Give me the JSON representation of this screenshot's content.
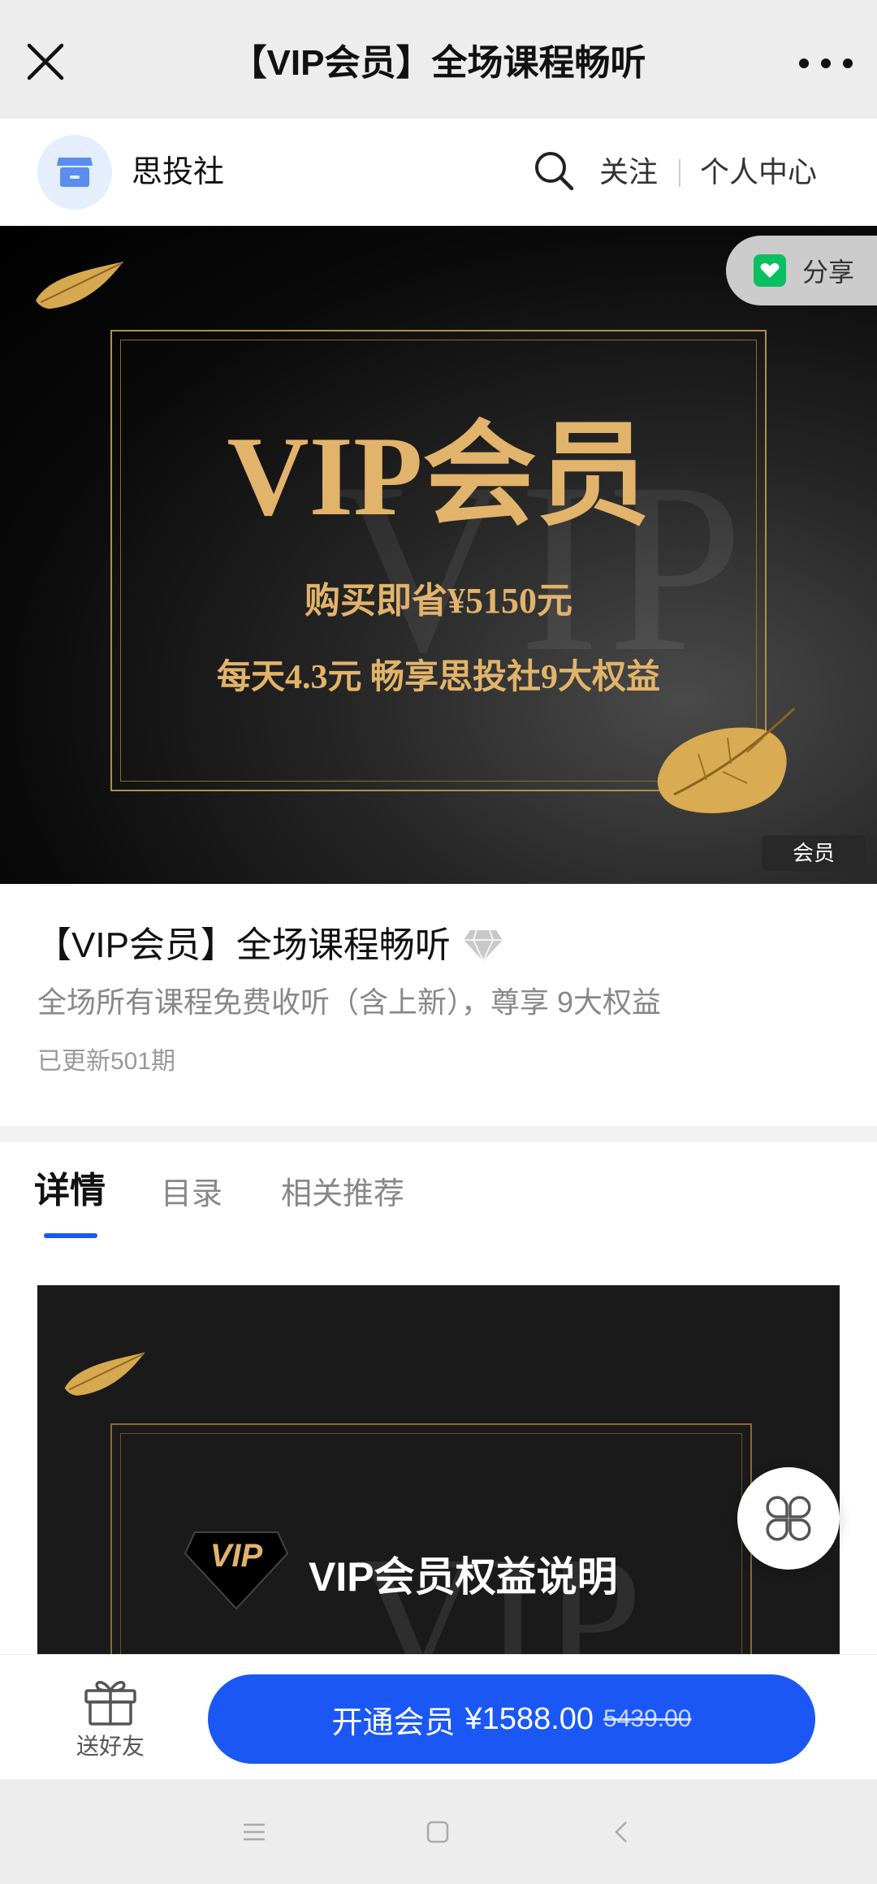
{
  "window": {
    "title": "【VIP会员】全场课程畅听"
  },
  "shop": {
    "name": "思投社",
    "follow_label": "关注",
    "center_label": "个人中心"
  },
  "banner": {
    "headline": "VIP会员",
    "line1": "购买即省¥5150元",
    "line2": "每天4.3元  畅享思投社9大权益",
    "watermark": "VIP",
    "badge": "会员",
    "share_label": "分享",
    "gold_color": "#e2b36a"
  },
  "product": {
    "title": "【VIP会员】全场课程畅听",
    "description": "全场所有课程免费收听（含上新），尊享 9大权益",
    "updated": "已更新501期"
  },
  "tabs": [
    {
      "label": "详情",
      "active": true
    },
    {
      "label": "目录",
      "active": false
    },
    {
      "label": "相关推荐",
      "active": false
    }
  ],
  "detail": {
    "gem_text": "VIP",
    "title": "VIP会员权益说明",
    "watermark": "VIP"
  },
  "actions": {
    "gift_label": "送好友",
    "buy_label": "开通会员",
    "price": "¥1588.00",
    "original_price": "5439.00",
    "accent": "#1a57f5"
  },
  "icons": {
    "close": "close-icon",
    "more": "more-icon",
    "search": "search-icon",
    "shop": "shop-icon",
    "share": "wechat-share-icon",
    "diamond": "diamond-icon",
    "gift": "gift-icon",
    "float": "clover-menu-icon",
    "nav_menu": "menu-nav-icon",
    "nav_home": "home-nav-icon",
    "nav_back": "back-nav-icon"
  }
}
